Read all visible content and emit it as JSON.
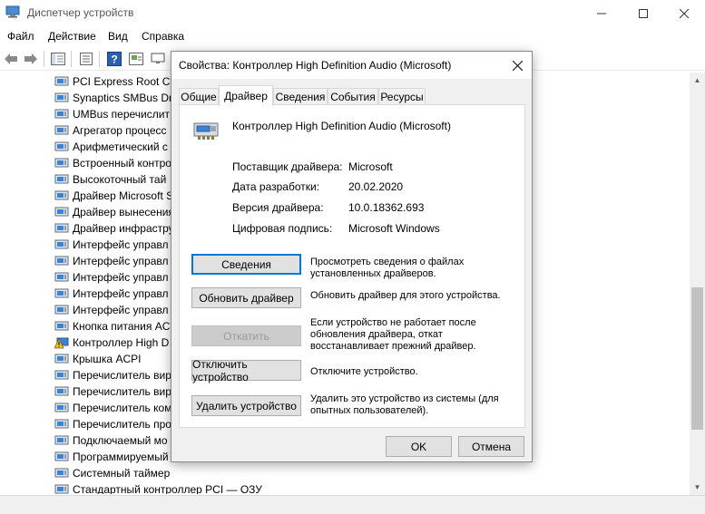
{
  "window": {
    "title": "Диспетчер устройств",
    "minimize_icon": "minimize-icon",
    "maximize_icon": "maximize-icon",
    "close_icon": "close-icon"
  },
  "menu": {
    "items": [
      "Файл",
      "Действие",
      "Вид",
      "Справка"
    ]
  },
  "tree": {
    "items": [
      "PCI Express Root Co",
      "Synaptics SMBus Dri",
      "UMBus перечислит",
      "Агрегатор процесс",
      "Арифметический с",
      "Встроенный контро",
      "Высокоточный тай",
      "Драйвер Microsoft S",
      "Драйвер вынесения",
      "Драйвер инфрастру",
      "Интерфейс управл",
      "Интерфейс управл",
      "Интерфейс управл",
      "Интерфейс управл",
      "Интерфейс управл",
      "Кнопка питания AC",
      "Контроллер High D",
      "Крышка ACPI",
      "Перечислитель вир",
      "Перечислитель вир",
      "Перечислитель ком",
      "Перечислитель про",
      "Подключаемый мо",
      "Программируемый",
      "Системный таймер",
      "Стандартный контроллер PCI — ОЗУ"
    ],
    "warning_item_index": 16
  },
  "dialog": {
    "title": "Свойства: Контроллер High Definition Audio (Microsoft)",
    "tabs": [
      "Общие",
      "Драйвер",
      "Сведения",
      "События",
      "Ресурсы"
    ],
    "active_tab": "Драйвер",
    "device_name": "Контроллер High Definition Audio (Microsoft)",
    "properties": [
      {
        "label": "Поставщик драйвера:",
        "value": "Microsoft"
      },
      {
        "label": "Дата разработки:",
        "value": "20.02.2020"
      },
      {
        "label": "Версия драйвера:",
        "value": "10.0.18362.693"
      },
      {
        "label": "Цифровая подпись:",
        "value": "Microsoft Windows"
      }
    ],
    "actions": [
      {
        "label": "Сведения",
        "desc": "Просмотреть сведения о файлах установленных драйверов."
      },
      {
        "label": "Обновить драйвер",
        "desc": "Обновить драйвер для этого устройства."
      },
      {
        "label": "Откатить",
        "desc": "Если устройство не работает после обновления драйвера, откат восстанавливает прежний драйвер."
      },
      {
        "label": "Отключить устройство",
        "desc": "Отключите устройство."
      },
      {
        "label": "Удалить устройство",
        "desc": "Удалить это устройство из системы (для опытных пользователей)."
      }
    ],
    "ok_label": "OK",
    "cancel_label": "Отмена"
  }
}
